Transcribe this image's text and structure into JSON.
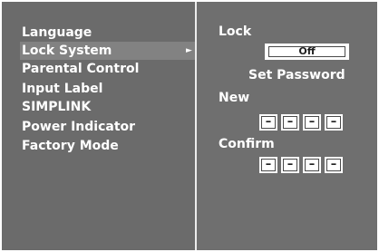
{
  "menu": {
    "items": [
      {
        "label": "Language"
      },
      {
        "label": "Lock System",
        "selected": true,
        "submenu_icon": "right-triangle-icon"
      },
      {
        "label": "Parental Control"
      },
      {
        "label": "Input Label"
      },
      {
        "label": "SIMPLINK"
      },
      {
        "label": "Power Indicator"
      },
      {
        "label": "Factory Mode"
      }
    ],
    "arrow_glyph": "►"
  },
  "lock_panel": {
    "lock_label": "Lock",
    "lock_value": "Off",
    "set_password_label": "Set Password",
    "new_label": "New",
    "new_digits": [
      "–",
      "–",
      "–",
      "–"
    ],
    "confirm_label": "Confirm",
    "confirm_digits": [
      "–",
      "–",
      "–",
      "–"
    ]
  },
  "colors": {
    "background": "#6d6d6d",
    "selected_row": "#828282",
    "divider": "#ececec",
    "text": "#ffffff"
  }
}
